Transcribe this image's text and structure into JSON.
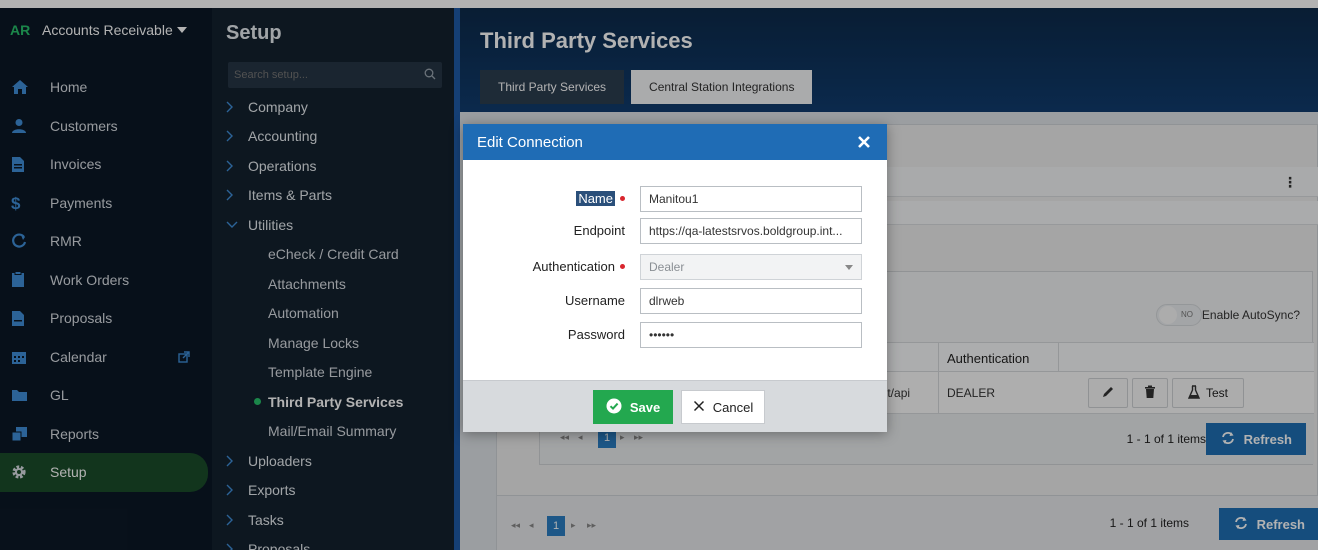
{
  "nav": {
    "badge": "AR",
    "app_name": "Accounts Receivable",
    "items": [
      {
        "label": "Home",
        "icon": "home-icon"
      },
      {
        "label": "Customers",
        "icon": "person-icon"
      },
      {
        "label": "Invoices",
        "icon": "document-icon"
      },
      {
        "label": "Payments",
        "icon": "dollar-icon"
      },
      {
        "label": "RMR",
        "icon": "recurring-icon"
      },
      {
        "label": "Work Orders",
        "icon": "clipboard-icon"
      },
      {
        "label": "Proposals",
        "icon": "proposal-icon"
      },
      {
        "label": "Calendar",
        "icon": "calendar-icon"
      },
      {
        "label": "GL",
        "icon": "folder-icon"
      },
      {
        "label": "Reports",
        "icon": "reports-icon"
      },
      {
        "label": "Setup",
        "icon": "gear-icon"
      }
    ],
    "active": "Setup"
  },
  "setup": {
    "title": "Setup",
    "search_placeholder": "Search setup...",
    "tree": {
      "top": [
        "Company",
        "Accounting",
        "Operations",
        "Items & Parts"
      ],
      "expanded": "Utilities",
      "children": [
        "eCheck / Credit Card",
        "Attachments",
        "Automation",
        "Manage Locks",
        "Template Engine",
        "Third Party Services",
        "Mail/Email Summary"
      ],
      "active_child": "Third Party Services",
      "bottom": [
        "Uploaders",
        "Exports",
        "Tasks",
        "Proposals"
      ]
    }
  },
  "main": {
    "title": "Third Party Services",
    "tabs": [
      {
        "label": "Third Party Services",
        "active": true
      },
      {
        "label": "Central Station Integrations",
        "active": false
      }
    ],
    "enable_autosync": {
      "label": "Enable AutoSync?",
      "toggle_text": "NO"
    },
    "grid": {
      "columns": [
        "Authentication"
      ],
      "row": {
        "endpoint_fragment": "p.int/api",
        "authentication": "DEALER"
      },
      "test_label": "Test"
    },
    "inner_pager": {
      "page": "1",
      "info": "1 - 1 of 1 items",
      "refresh": "Refresh"
    },
    "outer_pager": {
      "page": "1",
      "info": "1 - 1 of 1 items",
      "refresh": "Refresh"
    }
  },
  "modal": {
    "title": "Edit Connection",
    "fields": {
      "name": {
        "label": "Name",
        "value": "Manitou1"
      },
      "endpoint": {
        "label": "Endpoint",
        "value": "https://qa-latestsrvos.boldgroup.int..."
      },
      "authentication": {
        "label": "Authentication",
        "value": "Dealer"
      },
      "username": {
        "label": "Username",
        "value": "dlrweb"
      },
      "password": {
        "label": "Password",
        "value": "••••••"
      }
    },
    "save_label": "Save",
    "cancel_label": "Cancel"
  },
  "colors": {
    "accent_green": "#27c26b",
    "modal_header": "#1f6cb5",
    "save_green": "#23a84f",
    "refresh_blue": "#1f6fb4"
  }
}
